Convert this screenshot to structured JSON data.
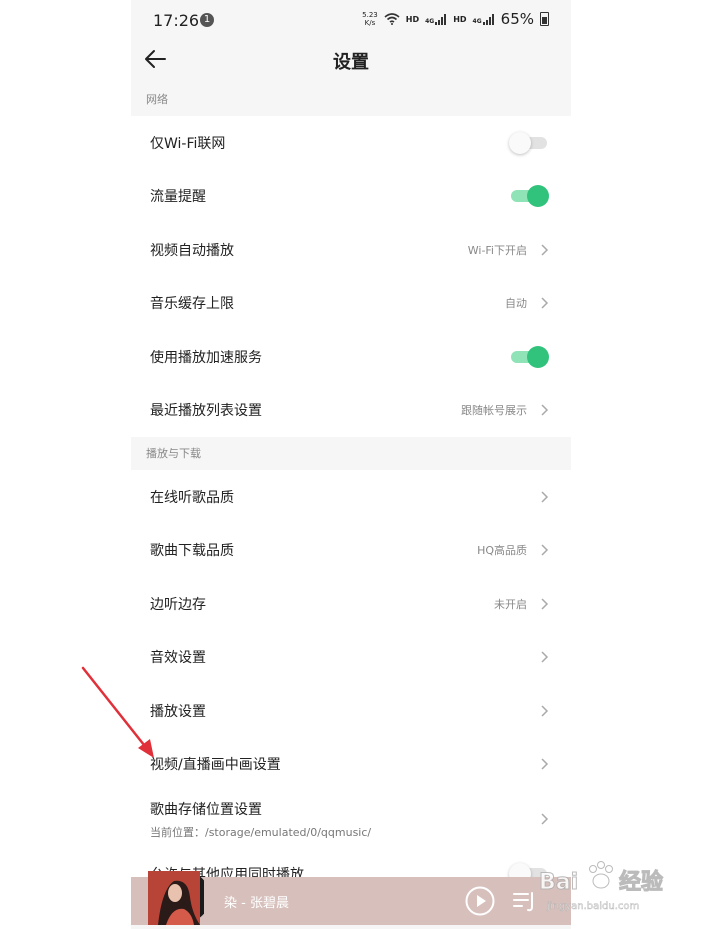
{
  "status_bar": {
    "time": "17:26",
    "notification_count": "1",
    "speed_value": "5.23",
    "speed_unit": "K/s",
    "hd1": "HD",
    "net1": "4G",
    "hd2": "HD",
    "net2": "4G",
    "battery": "65%"
  },
  "header": {
    "title": "设置"
  },
  "sections": {
    "network": {
      "title": "网络",
      "items": [
        {
          "label": "仅Wi-Fi联网",
          "toggle": false
        },
        {
          "label": "流量提醒",
          "toggle": true
        },
        {
          "label": "视频自动播放",
          "value": "Wi-Fi下开启"
        },
        {
          "label": "音乐缓存上限",
          "value": "自动"
        },
        {
          "label": "使用播放加速服务",
          "toggle": true
        },
        {
          "label": "最近播放列表设置",
          "value": "跟随帐号展示"
        }
      ]
    },
    "playback": {
      "title": "播放与下载",
      "items": [
        {
          "label": "在线听歌品质",
          "value": ""
        },
        {
          "label": "歌曲下载品质",
          "value": "HQ高品质"
        },
        {
          "label": "边听边存",
          "value": "未开启"
        },
        {
          "label": "音效设置",
          "value": ""
        },
        {
          "label": "播放设置",
          "value": ""
        },
        {
          "label": "视频/直播画中画设置",
          "value": ""
        },
        {
          "label": "歌曲存储位置设置",
          "sub": "当前位置：/storage/emulated/0/qqmusic/"
        },
        {
          "label": "允许与其他应用同时播放",
          "toggle": false
        }
      ]
    }
  },
  "player": {
    "title": "染 - 张碧晨"
  },
  "watermark": {
    "brand": "Bai",
    "brand2": "经验",
    "url": "jingyan.baidu.com"
  },
  "colors": {
    "accent": "#31c27c",
    "arrow": "#e0303a"
  }
}
